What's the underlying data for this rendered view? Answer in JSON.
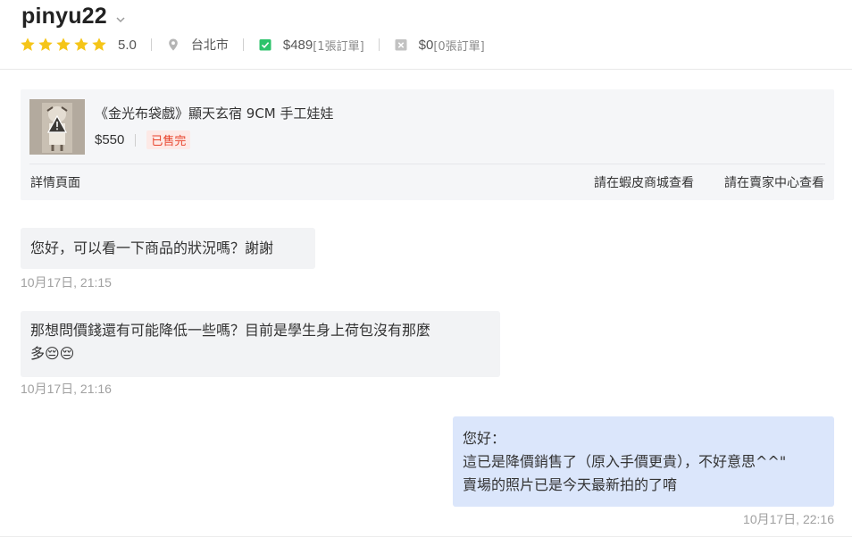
{
  "header": {
    "username": "pinyu22",
    "rating": "5.0",
    "star_count": 5,
    "location": "台北市",
    "completed_orders_value": "$489",
    "completed_orders_count": "[1張訂單]",
    "cancelled_orders_value": "$0",
    "cancelled_orders_count": "[0張訂單]",
    "icons": [
      "chevron-down-icon",
      "star-icon",
      "location-pin-icon",
      "check-box-icon",
      "cancel-box-icon"
    ]
  },
  "product": {
    "title": "《金光布袋戲》顯天玄宿 9CM 手工娃娃",
    "price": "$550",
    "status": "已售完",
    "detail_link": "詳情頁面",
    "shopee_link": "請在蝦皮商城查看",
    "seller_center_link": "請在賣家中心查看"
  },
  "messages": [
    {
      "direction": "incoming",
      "lines": [
        "您好，可以看一下商品的狀況嗎？謝謝"
      ],
      "time": "10月17日, 21:15"
    },
    {
      "direction": "incoming",
      "lines": [
        "那想問價錢還有可能降低一些嗎？目前是學生身上荷包沒有那麼",
        "多😔😔"
      ],
      "time": "10月17日, 21:16"
    },
    {
      "direction": "outgoing",
      "lines": [
        "您好：",
        "這已是降價銷售了（原入手價更貴），不好意思^^\"",
        "賣場的照片已是今天最新拍的了唷"
      ],
      "time": "10月17日, 22:16"
    }
  ],
  "colors": {
    "star": "#f5c518",
    "sold_text": "#e8442c",
    "outgoing_bubble": "#dbe6fb",
    "incoming_bubble": "#f2f3f5",
    "check_icon": "#2cc36b"
  }
}
